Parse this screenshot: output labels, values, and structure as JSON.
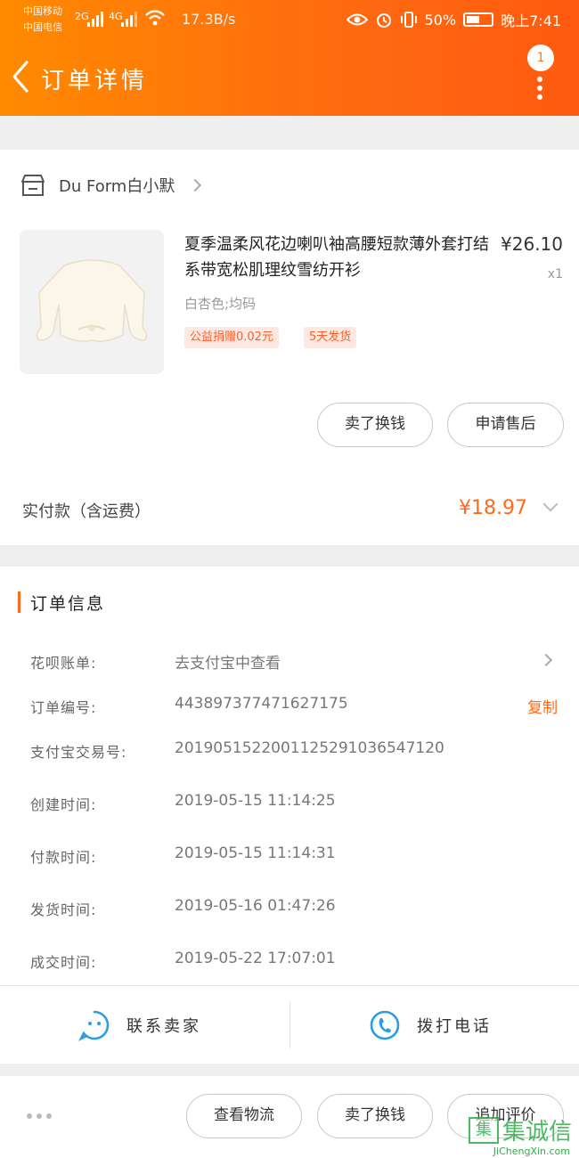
{
  "status_bar": {
    "carrier1": "中国移动",
    "carrier2": "中国电信",
    "net1": "2G",
    "net2": "4G",
    "speed": "17.3B/s",
    "battery": "50%",
    "time": "晚上7:41"
  },
  "nav": {
    "title": "订单详情",
    "badge": "1"
  },
  "shop": {
    "name": "Du Form白小默"
  },
  "product": {
    "title": "夏季温柔风花边喇叭袖高腰短款薄外套打结系带宽松肌理纹雪纺开衫",
    "price": "¥26.10",
    "qty": "x1",
    "sku": "白杏色;均码",
    "tags": [
      "公益捐赠0.02元",
      "5天发货"
    ],
    "actions": [
      "卖了换钱",
      "申请售后"
    ]
  },
  "payment": {
    "label": "实付款（含运费）",
    "amount": "¥18.97"
  },
  "order_info": {
    "title": "订单信息",
    "rows": [
      {
        "label": "花呗账单:",
        "value": "去支付宝中查看"
      },
      {
        "label": "订单编号:",
        "value": "443897377471627175"
      },
      {
        "label": "支付宝交易号:",
        "value": "2019051522001125291036547120"
      },
      {
        "label": "创建时间:",
        "value": "2019-05-15 11:14:25"
      },
      {
        "label": "付款时间:",
        "value": "2019-05-15 11:14:31"
      },
      {
        "label": "发货时间:",
        "value": "2019-05-16 01:47:26"
      },
      {
        "label": "成交时间:",
        "value": "2019-05-22 17:07:01"
      }
    ],
    "copy_label": "复制"
  },
  "contact": {
    "seller": "联系卖家",
    "phone": "拨打电话"
  },
  "bottom": {
    "actions": [
      "查看物流",
      "卖了换钱",
      "追加评价"
    ]
  },
  "watermark": {
    "brand": "集诚信",
    "url": "JiChengXin.com"
  },
  "colors": {
    "accent": "#ff6a1a",
    "header_start": "#ff8a00",
    "header_end": "#ff5a10"
  }
}
